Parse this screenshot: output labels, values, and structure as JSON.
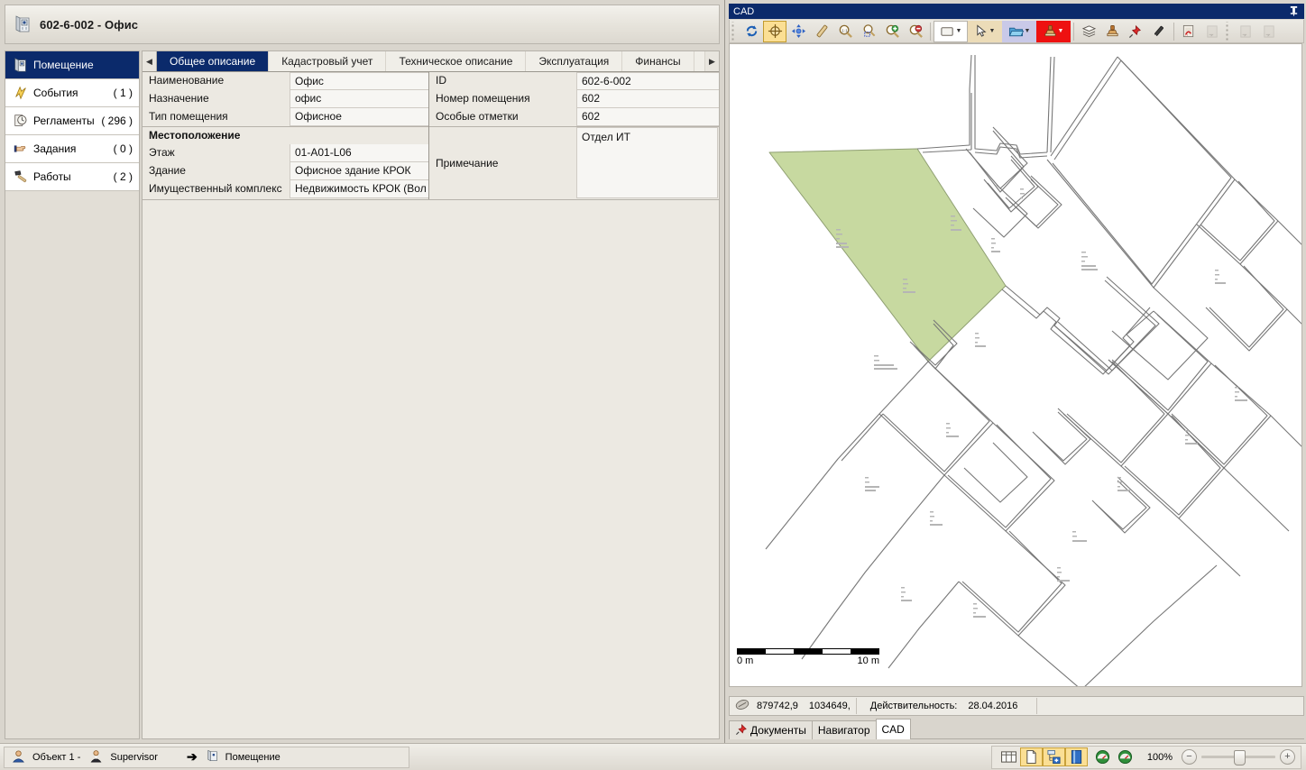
{
  "window": {
    "title": "602-6-002 - Офис",
    "title_icon": "building-icon"
  },
  "sidebar": {
    "items": [
      {
        "label": "Помещение",
        "count": "",
        "icon": "building-icon",
        "selected": true
      },
      {
        "label": "События",
        "count": "( 1 )",
        "icon": "lightning-icon",
        "selected": false
      },
      {
        "label": "Регламенты",
        "count": "( 296 )",
        "icon": "clock-document-icon",
        "selected": false
      },
      {
        "label": "Задания",
        "count": "( 0 )",
        "icon": "pointing-hand-icon",
        "selected": false
      },
      {
        "label": "Работы",
        "count": "( 2 )",
        "icon": "hammer-icon",
        "selected": false
      }
    ]
  },
  "tabs": {
    "prev_arrow": "◀",
    "next_arrow": "▶",
    "items": [
      {
        "label": "Общее описание",
        "active": true
      },
      {
        "label": "Кадастровый учет",
        "active": false
      },
      {
        "label": "Техническое описание",
        "active": false
      },
      {
        "label": "Эксплуатация",
        "active": false
      },
      {
        "label": "Финансы",
        "active": false
      }
    ]
  },
  "form": {
    "left_fields": [
      {
        "label": "Наименование",
        "value": "Офис"
      },
      {
        "label": "Назначение",
        "value": "офис"
      },
      {
        "label": "Тип помещения",
        "value": "Офисное"
      }
    ],
    "group_header": "Местоположение",
    "left_fields2": [
      {
        "label": "Этаж",
        "value": "01-A01-L06"
      },
      {
        "label": "Здание",
        "value": "Офисное здание КРОК"
      },
      {
        "label": "Имущественный комплекс",
        "value": "Недвижимость КРОК (Вол"
      }
    ],
    "right_fields": [
      {
        "label": "ID",
        "value": "602-6-002"
      },
      {
        "label": "Номер помещения",
        "value": "602"
      },
      {
        "label": "Особые отметки",
        "value": "602"
      }
    ],
    "note": {
      "label": "Примечание",
      "value": "Отдел ИТ"
    }
  },
  "cad": {
    "title": "CAD",
    "pin_icon": "pin-icon",
    "toolbar": [
      {
        "name": "refresh-icon",
        "active": false
      },
      {
        "name": "center-target-icon",
        "active": true
      },
      {
        "name": "pan-icon",
        "active": false
      },
      {
        "name": "measure-ruler-icon",
        "active": false
      },
      {
        "name": "zoom-actual-icon",
        "active": false
      },
      {
        "name": "zoom-window-icon",
        "active": false
      },
      {
        "name": "zoom-in-icon",
        "active": false
      },
      {
        "name": "zoom-out-icon",
        "active": false
      },
      {
        "name": "view-dropdown-icon",
        "active": false
      },
      {
        "name": "select-arrow-icon",
        "active": false
      },
      {
        "name": "open-folder-icon",
        "active": false
      },
      {
        "name": "stamp-red-icon",
        "active": false
      },
      {
        "name": "layers-icon",
        "active": false
      },
      {
        "name": "stamp-icon",
        "active": false
      },
      {
        "name": "push-pin-icon",
        "active": false
      },
      {
        "name": "pencil-icon",
        "active": false
      },
      {
        "name": "pdf-export-icon",
        "active": false
      }
    ],
    "scale": {
      "left_label": "0 m",
      "right_label": "10 m"
    },
    "status": {
      "coord_icon": "coordinate-icon",
      "coord_x": "879742,9",
      "coord_y": "1034649,",
      "validity_label": "Действительность:",
      "validity_value": "28.04.2016"
    },
    "bottom_tabs": [
      {
        "label": "Документы",
        "icon": "pin-doc-icon",
        "active": false
      },
      {
        "label": "Навигатор",
        "icon": "",
        "active": false
      },
      {
        "label": "CAD",
        "icon": "",
        "active": true
      }
    ],
    "selected_room_color": "#c7d9a0"
  },
  "statusbar": {
    "object_label": "Объект 1 -",
    "user_label": "Supervisor",
    "arrow": "➔",
    "context_label": "Помещение",
    "zoom_percent": "100%",
    "zoom_minus": "−",
    "zoom_plus": "+",
    "view_buttons": [
      {
        "name": "grid-view-icon",
        "active": false
      },
      {
        "name": "page-view-icon",
        "active": true
      },
      {
        "name": "tree-add-icon",
        "active": true
      },
      {
        "name": "book-view-icon",
        "active": true
      },
      {
        "name": "gauge-green-icon",
        "active": false
      },
      {
        "name": "gauge-green2-icon",
        "active": false
      }
    ]
  }
}
